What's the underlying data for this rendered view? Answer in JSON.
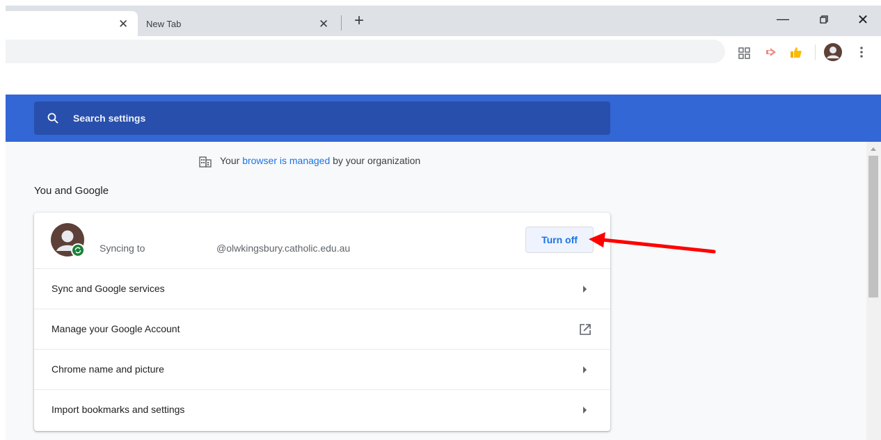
{
  "tabs": [
    {
      "title": "",
      "close": "✕"
    },
    {
      "title": "New Tab",
      "close": "✕"
    }
  ],
  "new_tab": "+",
  "window_controls": {
    "minimize": "—",
    "close": "✕"
  },
  "toolbar_icons": [
    "extensions-grid-icon",
    "cast-icon",
    "thumbs-up-extension-icon",
    "profile-avatar-icon",
    "more-menu-icon"
  ],
  "search": {
    "label": "Search settings"
  },
  "managed_notice": {
    "prefix": "Your ",
    "link": "browser is managed",
    "suffix": " by your organization"
  },
  "section_title": "You and Google",
  "sync_card": {
    "status_text": "Syncing to ",
    "email": "@olwkingsbury.catholic.edu.au",
    "turn_off": "Turn off"
  },
  "rows": [
    {
      "label": "Sync and Google services",
      "action": "arrow"
    },
    {
      "label": "Manage your Google Account",
      "action": "external-link"
    },
    {
      "label": "Chrome name and picture",
      "action": "arrow"
    },
    {
      "label": "Import bookmarks and settings",
      "action": "arrow"
    }
  ],
  "colors": {
    "header_blue": "#3367d6",
    "search_blue": "#284fab",
    "link_blue": "#1a73e8",
    "annotation_red": "#ff0000",
    "sync_badge_green": "#188038"
  }
}
